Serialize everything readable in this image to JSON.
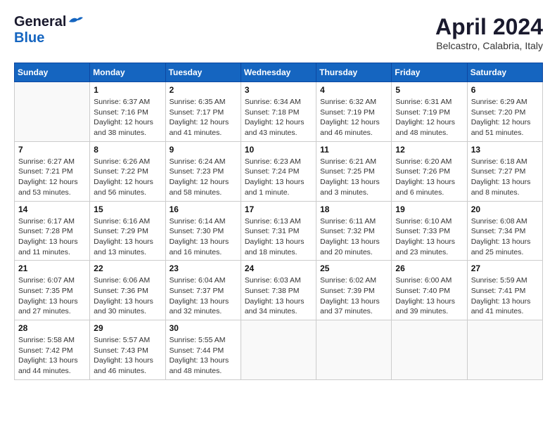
{
  "header": {
    "logo_general": "General",
    "logo_blue": "Blue",
    "month_title": "April 2024",
    "location": "Belcastro, Calabria, Italy"
  },
  "weekdays": [
    "Sunday",
    "Monday",
    "Tuesday",
    "Wednesday",
    "Thursday",
    "Friday",
    "Saturday"
  ],
  "weeks": [
    [
      {
        "day": "",
        "info": ""
      },
      {
        "day": "1",
        "info": "Sunrise: 6:37 AM\nSunset: 7:16 PM\nDaylight: 12 hours\nand 38 minutes."
      },
      {
        "day": "2",
        "info": "Sunrise: 6:35 AM\nSunset: 7:17 PM\nDaylight: 12 hours\nand 41 minutes."
      },
      {
        "day": "3",
        "info": "Sunrise: 6:34 AM\nSunset: 7:18 PM\nDaylight: 12 hours\nand 43 minutes."
      },
      {
        "day": "4",
        "info": "Sunrise: 6:32 AM\nSunset: 7:19 PM\nDaylight: 12 hours\nand 46 minutes."
      },
      {
        "day": "5",
        "info": "Sunrise: 6:31 AM\nSunset: 7:19 PM\nDaylight: 12 hours\nand 48 minutes."
      },
      {
        "day": "6",
        "info": "Sunrise: 6:29 AM\nSunset: 7:20 PM\nDaylight: 12 hours\nand 51 minutes."
      }
    ],
    [
      {
        "day": "7",
        "info": "Sunrise: 6:27 AM\nSunset: 7:21 PM\nDaylight: 12 hours\nand 53 minutes."
      },
      {
        "day": "8",
        "info": "Sunrise: 6:26 AM\nSunset: 7:22 PM\nDaylight: 12 hours\nand 56 minutes."
      },
      {
        "day": "9",
        "info": "Sunrise: 6:24 AM\nSunset: 7:23 PM\nDaylight: 12 hours\nand 58 minutes."
      },
      {
        "day": "10",
        "info": "Sunrise: 6:23 AM\nSunset: 7:24 PM\nDaylight: 13 hours\nand 1 minute."
      },
      {
        "day": "11",
        "info": "Sunrise: 6:21 AM\nSunset: 7:25 PM\nDaylight: 13 hours\nand 3 minutes."
      },
      {
        "day": "12",
        "info": "Sunrise: 6:20 AM\nSunset: 7:26 PM\nDaylight: 13 hours\nand 6 minutes."
      },
      {
        "day": "13",
        "info": "Sunrise: 6:18 AM\nSunset: 7:27 PM\nDaylight: 13 hours\nand 8 minutes."
      }
    ],
    [
      {
        "day": "14",
        "info": "Sunrise: 6:17 AM\nSunset: 7:28 PM\nDaylight: 13 hours\nand 11 minutes."
      },
      {
        "day": "15",
        "info": "Sunrise: 6:16 AM\nSunset: 7:29 PM\nDaylight: 13 hours\nand 13 minutes."
      },
      {
        "day": "16",
        "info": "Sunrise: 6:14 AM\nSunset: 7:30 PM\nDaylight: 13 hours\nand 16 minutes."
      },
      {
        "day": "17",
        "info": "Sunrise: 6:13 AM\nSunset: 7:31 PM\nDaylight: 13 hours\nand 18 minutes."
      },
      {
        "day": "18",
        "info": "Sunrise: 6:11 AM\nSunset: 7:32 PM\nDaylight: 13 hours\nand 20 minutes."
      },
      {
        "day": "19",
        "info": "Sunrise: 6:10 AM\nSunset: 7:33 PM\nDaylight: 13 hours\nand 23 minutes."
      },
      {
        "day": "20",
        "info": "Sunrise: 6:08 AM\nSunset: 7:34 PM\nDaylight: 13 hours\nand 25 minutes."
      }
    ],
    [
      {
        "day": "21",
        "info": "Sunrise: 6:07 AM\nSunset: 7:35 PM\nDaylight: 13 hours\nand 27 minutes."
      },
      {
        "day": "22",
        "info": "Sunrise: 6:06 AM\nSunset: 7:36 PM\nDaylight: 13 hours\nand 30 minutes."
      },
      {
        "day": "23",
        "info": "Sunrise: 6:04 AM\nSunset: 7:37 PM\nDaylight: 13 hours\nand 32 minutes."
      },
      {
        "day": "24",
        "info": "Sunrise: 6:03 AM\nSunset: 7:38 PM\nDaylight: 13 hours\nand 34 minutes."
      },
      {
        "day": "25",
        "info": "Sunrise: 6:02 AM\nSunset: 7:39 PM\nDaylight: 13 hours\nand 37 minutes."
      },
      {
        "day": "26",
        "info": "Sunrise: 6:00 AM\nSunset: 7:40 PM\nDaylight: 13 hours\nand 39 minutes."
      },
      {
        "day": "27",
        "info": "Sunrise: 5:59 AM\nSunset: 7:41 PM\nDaylight: 13 hours\nand 41 minutes."
      }
    ],
    [
      {
        "day": "28",
        "info": "Sunrise: 5:58 AM\nSunset: 7:42 PM\nDaylight: 13 hours\nand 44 minutes."
      },
      {
        "day": "29",
        "info": "Sunrise: 5:57 AM\nSunset: 7:43 PM\nDaylight: 13 hours\nand 46 minutes."
      },
      {
        "day": "30",
        "info": "Sunrise: 5:55 AM\nSunset: 7:44 PM\nDaylight: 13 hours\nand 48 minutes."
      },
      {
        "day": "",
        "info": ""
      },
      {
        "day": "",
        "info": ""
      },
      {
        "day": "",
        "info": ""
      },
      {
        "day": "",
        "info": ""
      }
    ]
  ]
}
